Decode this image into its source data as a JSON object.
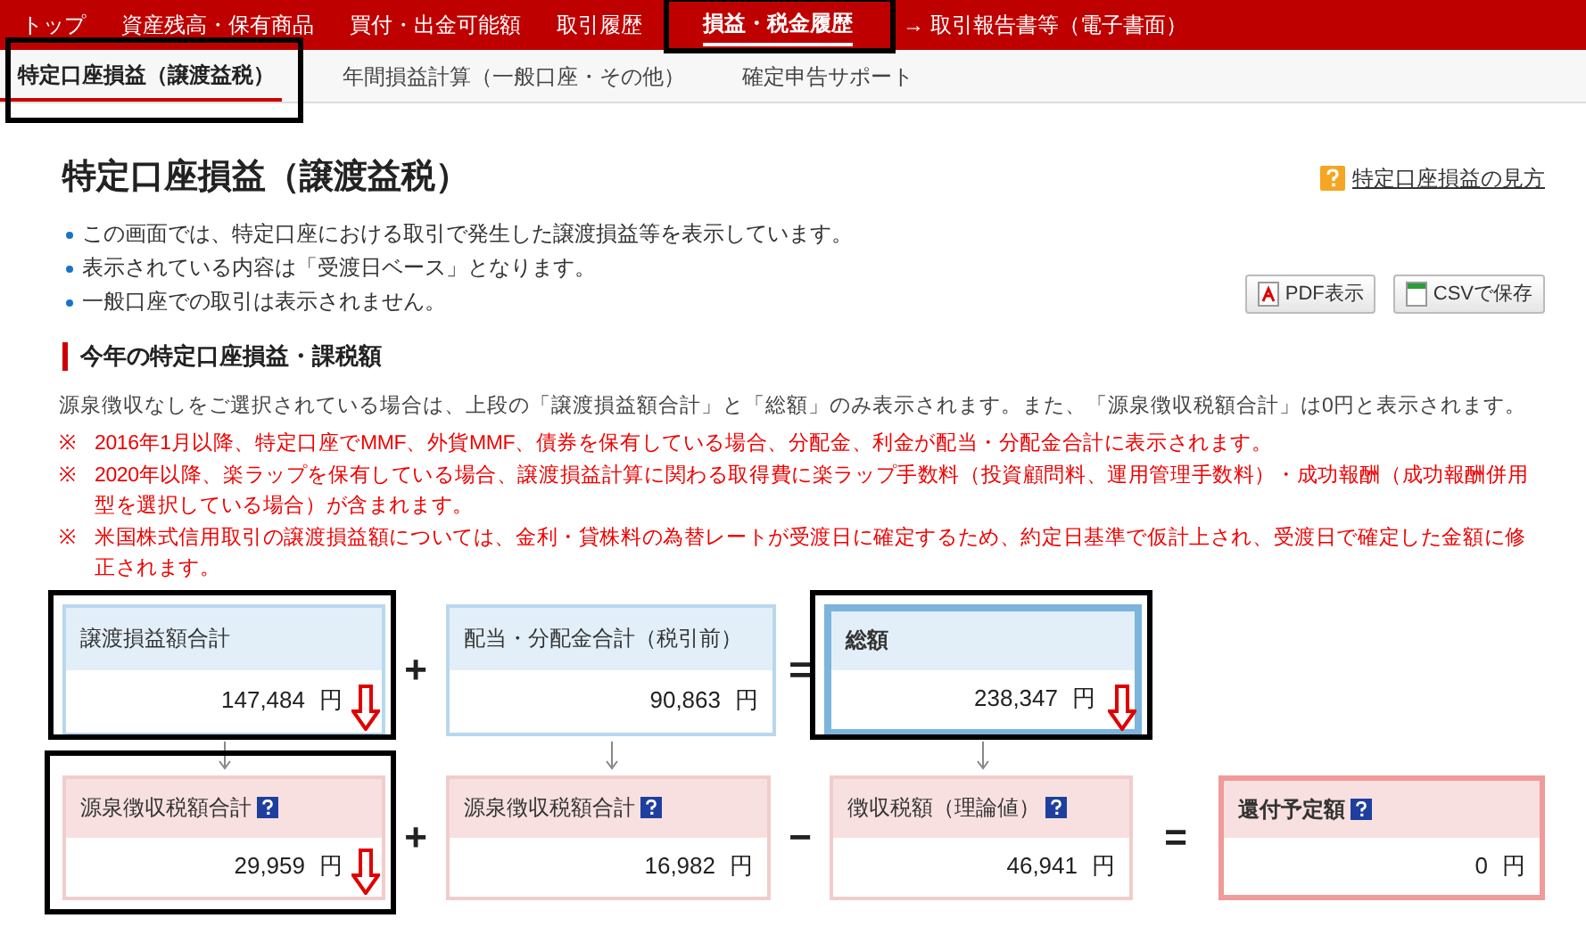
{
  "nav": [
    {
      "label": "トップ",
      "selected": false,
      "annotated": false
    },
    {
      "label": "資産残高・保有商品",
      "selected": false,
      "annotated": false
    },
    {
      "label": "買付・出金可能額",
      "selected": false,
      "annotated": false
    },
    {
      "label": "取引履歴",
      "selected": false,
      "annotated": false
    },
    {
      "label": "損益・税金履歴",
      "selected": true,
      "annotated": true
    },
    {
      "label": "→ 取引報告書等（電子書面）",
      "selected": false,
      "annotated": false
    }
  ],
  "subtabs": [
    {
      "label": "特定口座損益（譲渡益税）",
      "selected": true,
      "annotated": true
    },
    {
      "label": "年間損益計算（一般口座・その他）",
      "selected": false,
      "annotated": false
    },
    {
      "label": "確定申告サポート",
      "selected": false,
      "annotated": false
    }
  ],
  "page_title": "特定口座損益（譲渡益税）",
  "help_link": "特定口座損益の見方",
  "bullets": [
    "この画面では、特定口座における取引で発生した譲渡損益等を表示しています。",
    "表示されている内容は「受渡日ベース」となります。",
    "一般口座での取引は表示されません。"
  ],
  "buttons": [
    {
      "label": "PDF表示",
      "kind": "pdf"
    },
    {
      "label": "CSVで保存",
      "kind": "csv"
    }
  ],
  "section_title": "今年の特定口座損益・課税額",
  "note": "源泉徴収なしをご選択されている場合は、上段の「譲渡損益額合計」と「総額」のみ表示されます。また、「源泉徴収税額合計」は0円と表示されます。",
  "warnings": [
    {
      "mark": "※",
      "text": "2016年1月以降、特定口座でMMF、外貨MMF、債券を保有している場合、分配金、利金が配当・分配金合計に表示されます。"
    },
    {
      "mark": "※",
      "text": "2020年以降、楽ラップを保有している場合、譲渡損益計算に関わる取得費に楽ラップ手数料（投資顧問料、運用管理手数料）・成功報酬（成功報酬併用型を選択している場合）が含まれます。"
    },
    {
      "mark": "※",
      "text": "米国株式信用取引の譲渡損益額については、金利・貸株料の為替レートが受渡日に確定するため、約定日基準で仮計上され、受渡日で確定した金額に修正されます。"
    }
  ],
  "rows": [
    [
      {
        "kind": "card",
        "label": "譲渡損益額合計",
        "value": "147,484",
        "unit": "円",
        "help": false,
        "connector": true,
        "annotated": true,
        "arrow": true
      },
      {
        "kind": "operator",
        "text": "+"
      },
      {
        "kind": "card",
        "label": "配当・分配金合計（税引前）",
        "value": "90,863",
        "unit": "円",
        "help": false,
        "connector": true,
        "annotated": false,
        "arrow": false
      },
      {
        "kind": "operator",
        "text": "="
      },
      {
        "kind": "total",
        "label": "総額",
        "value": "238,347",
        "unit": "円",
        "help": false,
        "connector": true,
        "annotated": true,
        "arrow": true
      }
    ],
    [
      {
        "kind": "card",
        "label": "源泉徴収税額合計",
        "value": "29,959",
        "unit": "円",
        "help": true,
        "connector": false,
        "annotated": true,
        "arrow": true
      },
      {
        "kind": "operator",
        "text": "+"
      },
      {
        "kind": "card",
        "label": "源泉徴収税額合計",
        "value": "16,982",
        "unit": "円",
        "help": true,
        "connector": false,
        "annotated": false,
        "arrow": false
      },
      {
        "kind": "operator",
        "text": "−"
      },
      {
        "kind": "card",
        "label": "徴収税額（理論値）",
        "value": "46,941",
        "unit": "円",
        "help": true,
        "connector": false,
        "annotated": false,
        "arrow": false
      },
      {
        "kind": "operator",
        "text": "="
      },
      {
        "kind": "total",
        "label": "還付予定額",
        "value": "0",
        "unit": "円",
        "help": true,
        "connector": false,
        "annotated": false,
        "arrow": false
      }
    ]
  ]
}
